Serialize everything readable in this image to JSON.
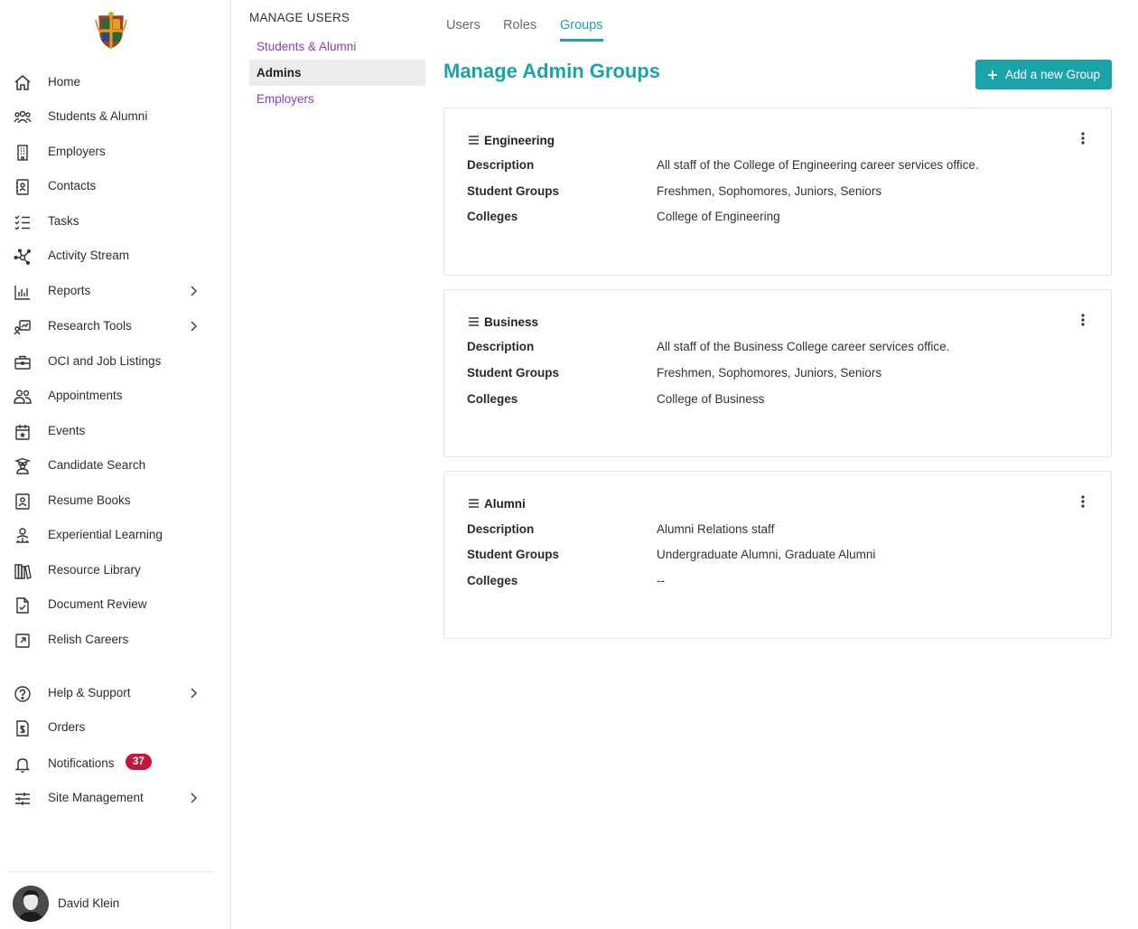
{
  "sidebar": {
    "items": [
      {
        "label": "Home",
        "icon": "home-icon"
      },
      {
        "label": "Students & Alumni",
        "icon": "people-group-icon"
      },
      {
        "label": "Employers",
        "icon": "building-icon"
      },
      {
        "label": "Contacts",
        "icon": "contact-card-icon"
      },
      {
        "label": "Tasks",
        "icon": "checklist-icon"
      },
      {
        "label": "Activity Stream",
        "icon": "network-icon"
      },
      {
        "label": "Reports",
        "icon": "bar-chart-icon",
        "chevron": true
      },
      {
        "label": "Research Tools",
        "icon": "research-icon",
        "chevron": true
      },
      {
        "label": "OCI and Job Listings",
        "icon": "briefcase-icon"
      },
      {
        "label": "Appointments",
        "icon": "two-people-icon"
      },
      {
        "label": "Events",
        "icon": "calendar-star-icon"
      },
      {
        "label": "Candidate Search",
        "icon": "graduate-icon"
      },
      {
        "label": "Resume Books",
        "icon": "resume-icon"
      },
      {
        "label": "Experiential Learning",
        "icon": "person-tree-icon"
      },
      {
        "label": "Resource Library",
        "icon": "books-icon"
      },
      {
        "label": "Document Review",
        "icon": "document-check-icon"
      },
      {
        "label": "Relish Careers",
        "icon": "external-link-icon"
      },
      {
        "label": "Help & Support",
        "icon": "help-icon",
        "chevron": true
      },
      {
        "label": "Orders",
        "icon": "receipt-icon"
      },
      {
        "label": "Notifications",
        "icon": "bell-icon",
        "badge": "37"
      },
      {
        "label": "Site Management",
        "icon": "sliders-icon",
        "chevron": true
      }
    ],
    "user": {
      "name": "David Klein"
    },
    "badge_color": "#c4173c"
  },
  "subnav": {
    "title": "MANAGE USERS",
    "items": [
      {
        "label": "Students & Alumni"
      },
      {
        "label": "Admins",
        "active": true
      },
      {
        "label": "Employers"
      }
    ],
    "link_color": "#8a3cc4"
  },
  "main": {
    "tabs": [
      {
        "label": "Users"
      },
      {
        "label": "Roles"
      },
      {
        "label": "Groups",
        "active": true
      }
    ],
    "title": "Manage Admin Groups",
    "add_button": "Add a new Group",
    "accent_color": "#1aa3a8",
    "field_labels": {
      "description": "Description",
      "student_groups": "Student Groups",
      "colleges": "Colleges"
    },
    "groups": [
      {
        "name": "Engineering",
        "description": "All staff of the College of Engineering career services office.",
        "student_groups": "Freshmen, Sophomores, Juniors, Seniors",
        "colleges": "College of Engineering"
      },
      {
        "name": "Business",
        "description": "All staff of the Business College career services office.",
        "student_groups": "Freshmen, Sophomores, Juniors, Seniors",
        "colleges": "College of Business"
      },
      {
        "name": "Alumni",
        "description": "Alumni Relations staff",
        "student_groups": "Undergraduate Alumni, Graduate Alumni",
        "colleges": "--"
      }
    ]
  }
}
